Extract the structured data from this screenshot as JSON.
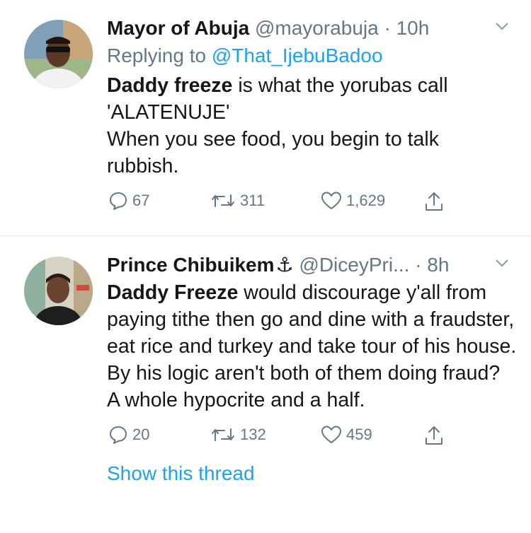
{
  "tweets": [
    {
      "name": "Mayor of Abuja",
      "handle": "@mayorabuja",
      "dot": "·",
      "time": "10h",
      "replying_prefix": "Replying to",
      "replying_handle": "@That_IjebuBadoo",
      "body": {
        "bold": "Daddy freeze",
        "rest": " is what the yorubas call 'ALATENUJE'",
        "line2": "When you see food, you begin to talk rubbish."
      },
      "counts": {
        "replies": "67",
        "retweets": "311",
        "likes": "1,629"
      },
      "icons": {
        "chevron": "chevron-down-icon",
        "reply": "reply-icon",
        "retweet": "retweet-icon",
        "like": "heart-icon",
        "share": "share-icon"
      }
    },
    {
      "name": "Prince Chibuikem",
      "name_emoji": "⚓",
      "handle": "@DiceyPri...",
      "dot": "·",
      "time": "8h",
      "body": {
        "bold": "Daddy Freeze",
        "rest": " would discourage y'all from paying tithe then go and dine with a fraudster, eat rice and turkey and take tour of his house. By his logic aren't both of them doing fraud?",
        "line2": "A whole hypocrite and a half."
      },
      "counts": {
        "replies": "20",
        "retweets": "132",
        "likes": "459"
      },
      "show_thread": "Show this thread",
      "icons": {
        "chevron": "chevron-down-icon",
        "reply": "reply-icon",
        "retweet": "retweet-icon",
        "like": "heart-icon",
        "share": "share-icon"
      }
    }
  ],
  "colors": {
    "link": "#1da1f2",
    "muted": "#657786",
    "text": "#14171a",
    "divider": "#e1e8ed"
  }
}
